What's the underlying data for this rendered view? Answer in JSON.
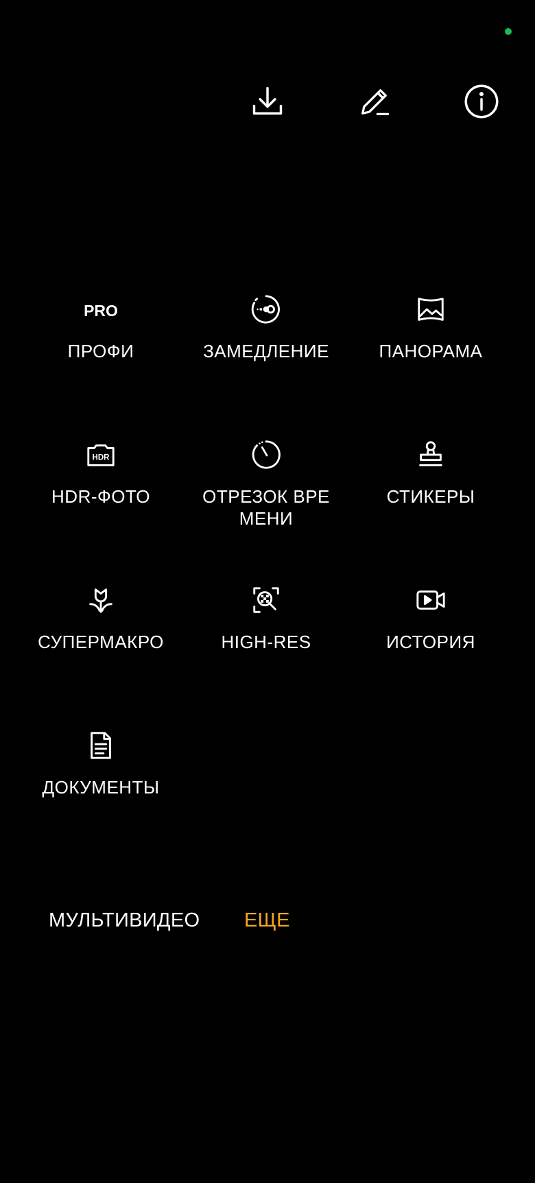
{
  "status": {
    "indicator_color": "#1db954"
  },
  "toolbar": {
    "download_icon": "download-icon",
    "edit_icon": "pencil-icon",
    "info_icon": "info-icon"
  },
  "modes": [
    {
      "label": "ПРОФИ",
      "icon": "pro-text-icon",
      "icon_text": "PRO"
    },
    {
      "label": "ЗАМЕДЛЕНИЕ",
      "icon": "slow-motion-icon"
    },
    {
      "label": "ПАНОРАМА",
      "icon": "panorama-icon"
    },
    {
      "label": "HDR-ФОТО",
      "icon": "hdr-icon",
      "icon_text": "HDR"
    },
    {
      "label": "ОТРЕЗОК ВРЕМЕНИ",
      "icon": "timelapse-icon"
    },
    {
      "label": "СТИКЕРЫ",
      "icon": "sticker-stamp-icon"
    },
    {
      "label": "СУПЕРМАКРО",
      "icon": "macro-flower-icon"
    },
    {
      "label": "HIGH-RES",
      "icon": "high-res-icon"
    },
    {
      "label": "ИСТОРИЯ",
      "icon": "story-video-icon"
    },
    {
      "label": "ДОКУМЕНТЫ",
      "icon": "document-icon"
    }
  ],
  "bottom_tabs": {
    "multivideo": "МУЛЬТИВИДЕО",
    "more": "ЕЩЕ"
  },
  "colors": {
    "background": "#000000",
    "text": "#ffffff",
    "active_tab": "#f5a623",
    "status_dot": "#1db954"
  }
}
